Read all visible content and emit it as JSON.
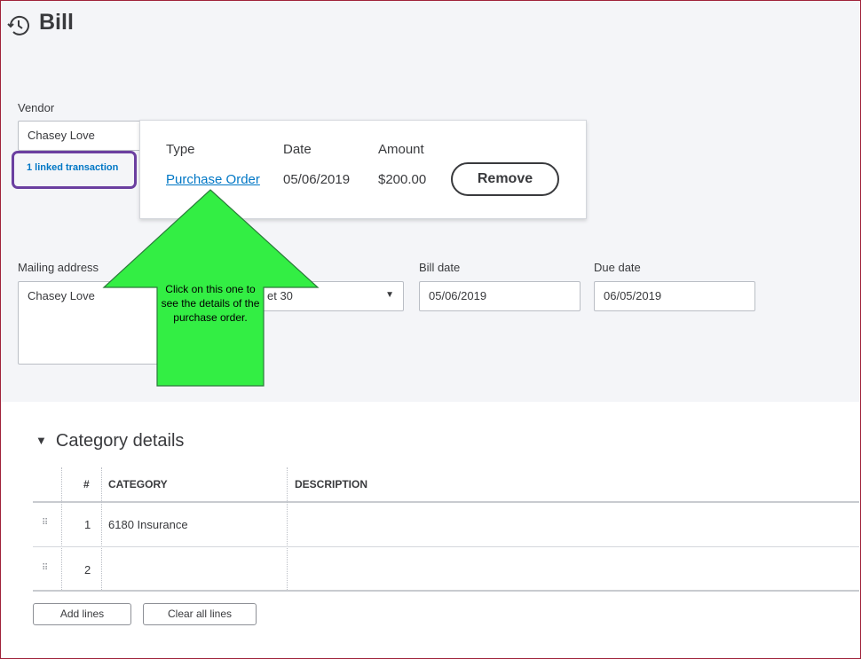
{
  "page": {
    "title": "Bill"
  },
  "vendor": {
    "label": "Vendor",
    "value": "Chasey Love",
    "linked_transactions": "1 linked transaction"
  },
  "linked_popover": {
    "headers": {
      "type": "Type",
      "date": "Date",
      "amount": "Amount"
    },
    "row": {
      "type": "Purchase Order",
      "date": "05/06/2019",
      "amount": "$200.00"
    },
    "remove_label": "Remove"
  },
  "mailing_address": {
    "label": "Mailing address",
    "value": "Chasey Love"
  },
  "terms": {
    "value_visible": "et 30"
  },
  "bill_date": {
    "label": "Bill date",
    "value": "05/06/2019"
  },
  "due_date": {
    "label": "Due date",
    "value": "06/05/2019"
  },
  "annotation": {
    "text": "Click on this one to see the details of the purchase order.",
    "color": "#33ee44"
  },
  "category_details": {
    "title": "Category details",
    "columns": [
      "#",
      "CATEGORY",
      "DESCRIPTION"
    ],
    "rows": [
      {
        "num": "1",
        "category": "6180 Insurance",
        "description": ""
      },
      {
        "num": "2",
        "category": "",
        "description": ""
      }
    ],
    "add_lines_label": "Add lines",
    "clear_lines_label": "Clear all lines"
  },
  "colors": {
    "link": "#0077c5",
    "highlight_border": "#6b3fa0",
    "frame_border": "#a0223a"
  }
}
